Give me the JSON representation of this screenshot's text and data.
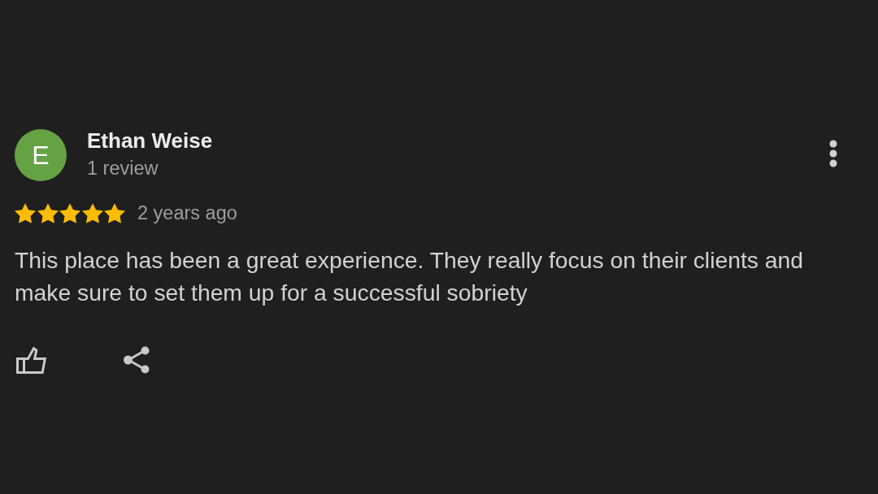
{
  "review": {
    "avatar_initial": "E",
    "author": "Ethan Weise",
    "author_meta": "1 review",
    "stars": 5,
    "time": "2 years ago",
    "text": "This place has been a great experience. They really focus on their clients and make sure to set them up for a successful sobriety"
  }
}
